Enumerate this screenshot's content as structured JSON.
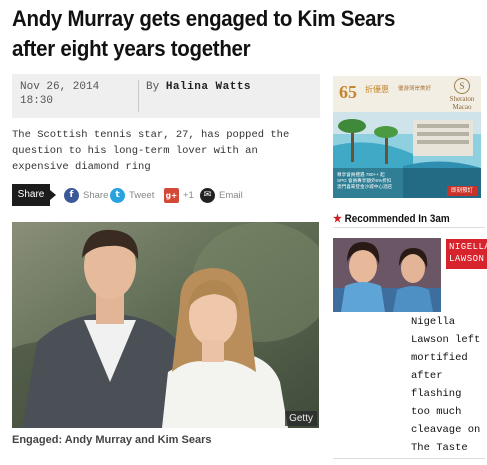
{
  "article": {
    "headline": "Andy Murray gets engaged to Kim Sears after eight years together",
    "date": "Nov 26, 2014",
    "time": "18:30",
    "by_label": "By",
    "author": "Halina Watts",
    "summary": "The Scottish tennis star, 27, has popped the question to his long-term lover with an expensive diamond ring",
    "photo_credit": "Getty",
    "caption": "Engaged: Andy Murray and Kim Sears"
  },
  "share": {
    "label": "Share",
    "items": [
      {
        "name": "facebook",
        "icon_char": "f",
        "color": "#3b5998",
        "label": "Share"
      },
      {
        "name": "twitter",
        "icon_char": "t",
        "color": "#29a3e0",
        "label": "Tweet"
      },
      {
        "name": "googleplus",
        "icon_char": "g+",
        "color": "#d34836",
        "label": "+1"
      },
      {
        "name": "email",
        "icon_char": "✉",
        "color": "#222222",
        "label": "Email"
      }
    ]
  },
  "ad": {
    "price": "65",
    "discount": "折優惠",
    "tagline": "優游灣岸美好",
    "brand": "Sheraton",
    "brand_sub": "Macao",
    "promo_lines": [
      "尊享會員禮遇 780++ 起",
      "SPG 會員專享額外5%折扣",
      "澳門喜來登金沙城中心酒店"
    ],
    "cta": "即刻預訂"
  },
  "recommended": {
    "title": "Recommended In 3am",
    "tag": "NIGELLA LAWSON",
    "headline": "Nigella Lawson left mortified after flashing too much cleavage on The Taste"
  },
  "colors": {
    "accent_red": "#d6232c",
    "star_red": "#cc1f1f",
    "meta_bg": "#efefef",
    "share_dark": "#1c1c1c"
  }
}
